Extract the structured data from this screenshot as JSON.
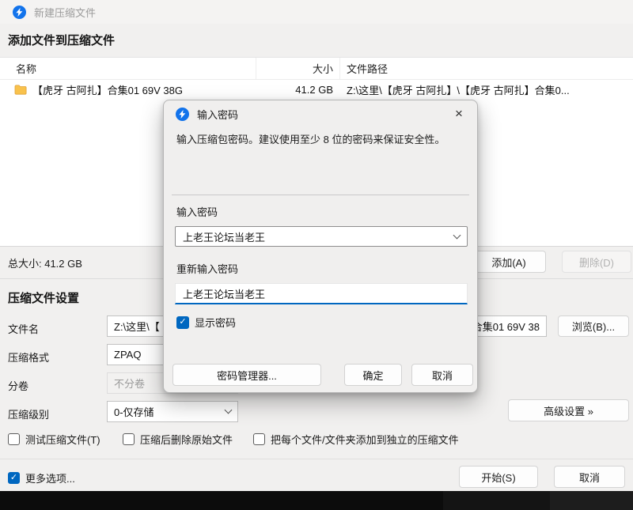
{
  "window": {
    "titlebar": {
      "title": "新建压缩文件"
    },
    "section_add_title": "添加文件到压缩文件",
    "table": {
      "columns": [
        "名称",
        "大小",
        "文件路径"
      ],
      "rows": [
        {
          "name": "【虎牙 古阿扎】合集01 69V 38G",
          "size": "41.2 GB",
          "path": "Z:\\这里\\【虎牙 古阿扎】\\【虎牙 古阿扎】合集0..."
        }
      ]
    },
    "summary": {
      "total": "总大小: 41.2 GB",
      "add_button": "添加(A)",
      "delete_button": "删除(D)"
    },
    "settings": {
      "heading": "压缩文件设置",
      "filename_label": "文件名",
      "filename_value_left": "Z:\\这里\\【",
      "filename_value_right": "合集01 69V 38",
      "browse_button": "浏览(B)...",
      "format_label": "压缩格式",
      "format_value": "ZPAQ",
      "volume_label": "分卷",
      "volume_value": "不分卷",
      "level_label": "压缩级别",
      "level_value": "0-仅存储",
      "advanced_button": "高级设置 »"
    },
    "options": {
      "test_checkbox": "测试压缩文件(T)",
      "delete_after_checkbox": "压缩后删除原始文件",
      "separate_checkbox": "把每个文件/文件夹添加到独立的压缩文件",
      "more_options_checkbox": "更多选项..."
    },
    "footer": {
      "start_button": "开始(S)",
      "cancel_button": "取消"
    }
  },
  "dialog": {
    "title": "输入密码",
    "description": "输入压缩包密码。建议使用至少 8 位的密码来保证安全性。",
    "password_label": "输入密码",
    "password_value": "上老王论坛当老王",
    "confirm_label": "重新输入密码",
    "confirm_value": "上老王论坛当老王",
    "show_password_label": "显示密码",
    "password_manager_button": "密码管理器...",
    "ok_button": "确定",
    "cancel_button": "取消"
  },
  "icons": {
    "check": "✓",
    "close": "×"
  },
  "colors": {
    "accent": "#0067c0",
    "app_icon_blue": "#1273eb",
    "folder_yellow": "#f9c24c"
  }
}
